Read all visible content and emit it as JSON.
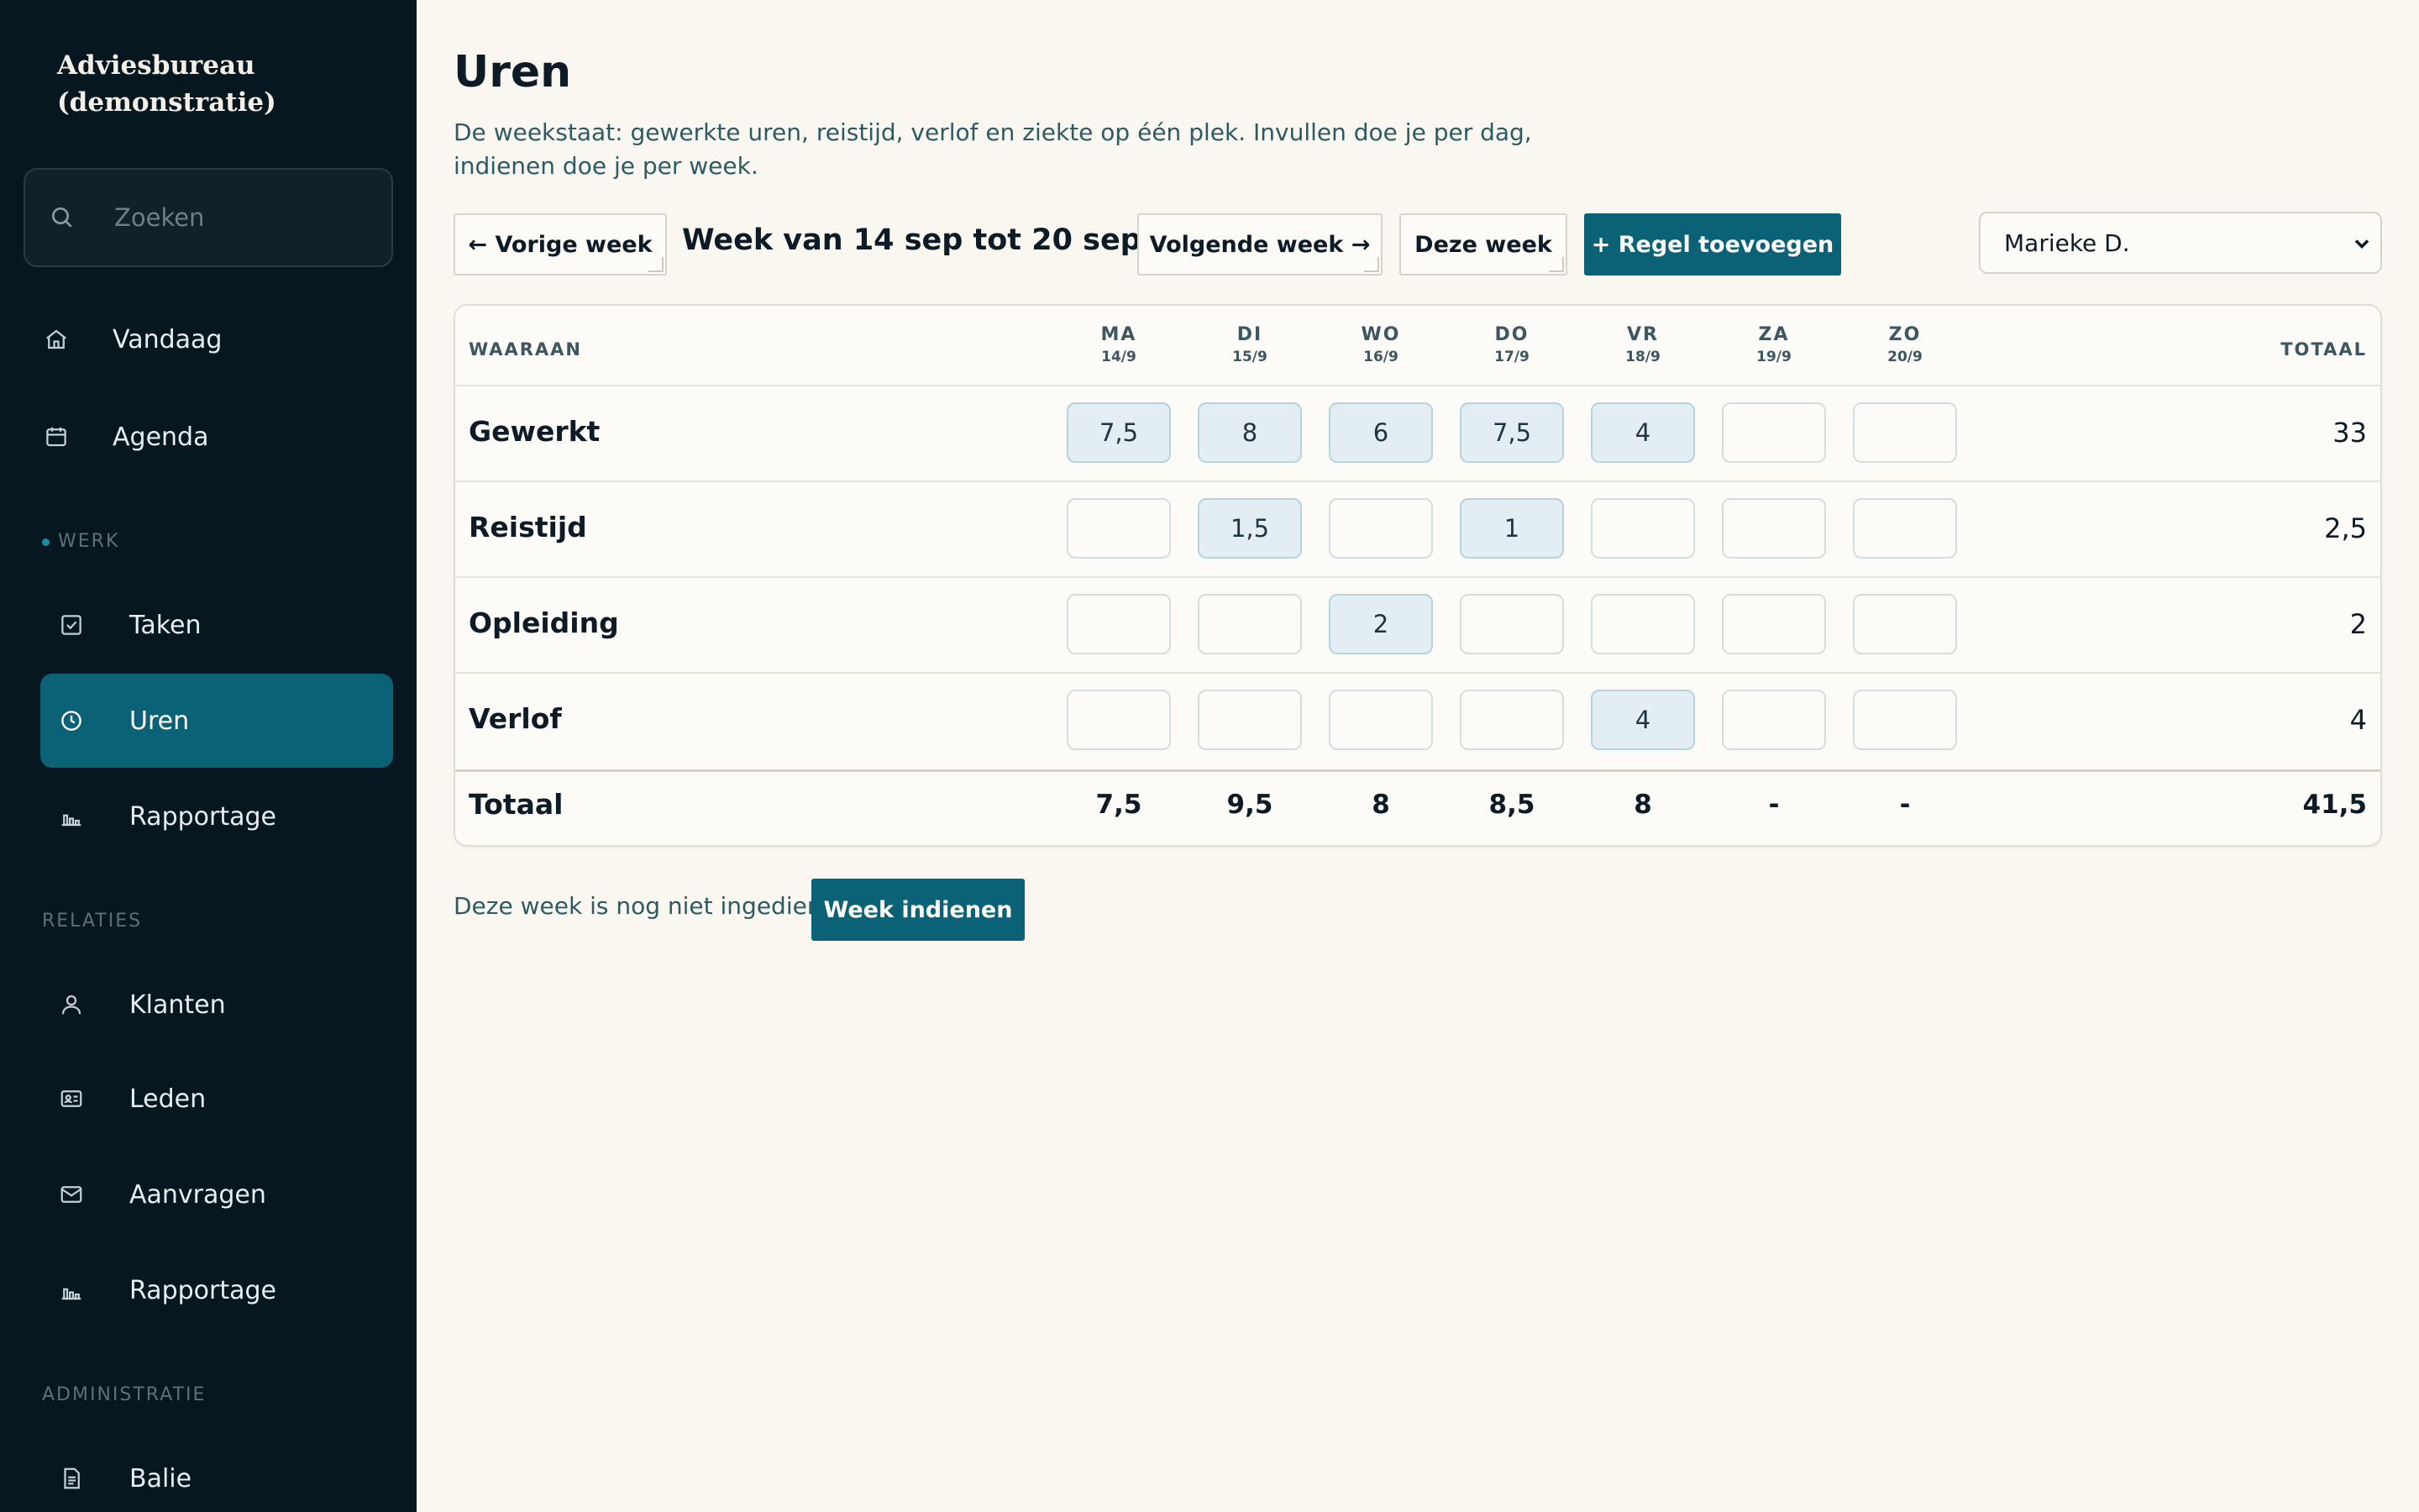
{
  "sidebar": {
    "brand": "Adviesbureau (demonstratie)",
    "search_placeholder": "Zoeken",
    "top_items": [
      {
        "label": "Vandaag",
        "icon": "home-icon"
      },
      {
        "label": "Agenda",
        "icon": "calendar-icon"
      }
    ],
    "sections": [
      {
        "label": "WERK",
        "items": [
          {
            "label": "Taken",
            "icon": "checkbox-icon"
          },
          {
            "label": "Uren",
            "icon": "clock-icon",
            "active": true
          },
          {
            "label": "Rapportage",
            "icon": "bar-chart-icon"
          }
        ]
      },
      {
        "label": "RELATIES",
        "items": [
          {
            "label": "Klanten",
            "icon": "user-icon"
          },
          {
            "label": "Leden",
            "icon": "id-card-icon"
          },
          {
            "label": "Aanvragen",
            "icon": "mail-icon"
          },
          {
            "label": "Rapportage",
            "icon": "bar-chart-icon"
          }
        ]
      },
      {
        "label": "ADMINISTRATIE",
        "items": [
          {
            "label": "Balie",
            "icon": "document-icon"
          }
        ]
      }
    ]
  },
  "header": {
    "title": "Uren",
    "description": "De weekstaat: gewerkte uren, reistijd, verlof en ziekte op één plek. Invullen doe je per dag, indienen doe je per week."
  },
  "toolbar": {
    "prev_label": "← Vorige week",
    "week_label": "Week van 14 sep tot 20 sep",
    "next_label": "Volgende week →",
    "today_label": "Deze week",
    "add_label": "+ Regel toevoegen",
    "user_selected": "Marieke D."
  },
  "table": {
    "col_label": "WAARAAN",
    "total_label": "TOTAAL",
    "days": [
      {
        "d": "MA",
        "date": "14/9"
      },
      {
        "d": "DI",
        "date": "15/9"
      },
      {
        "d": "WO",
        "date": "16/9"
      },
      {
        "d": "DO",
        "date": "17/9"
      },
      {
        "d": "VR",
        "date": "18/9"
      },
      {
        "d": "ZA",
        "date": "19/9"
      },
      {
        "d": "ZO",
        "date": "20/9"
      }
    ],
    "rows": [
      {
        "label": "Gewerkt",
        "values": [
          "7,5",
          "8",
          "6",
          "7,5",
          "4",
          "",
          ""
        ],
        "total": "33"
      },
      {
        "label": "Reistijd",
        "values": [
          "",
          "1,5",
          "",
          "1",
          "",
          "",
          ""
        ],
        "total": "2,5"
      },
      {
        "label": "Opleiding",
        "values": [
          "",
          "",
          "2",
          "",
          "",
          "",
          ""
        ],
        "total": "2"
      },
      {
        "label": "Verlof",
        "values": [
          "",
          "",
          "",
          "",
          "4",
          "",
          ""
        ],
        "total": "4"
      }
    ],
    "footer": {
      "label": "Totaal",
      "values": [
        "7,5",
        "9,5",
        "8",
        "8,5",
        "8",
        "-",
        "-"
      ],
      "total": "41,5"
    }
  },
  "status": {
    "text": "Deze week is nog niet ingediend.",
    "submit_label": "Week indienen"
  },
  "colors": {
    "sidebar_bg": "#07171f",
    "accent": "#0b6175",
    "page_bg": "#faf6f0",
    "filled_cell": "#e2eef3"
  }
}
